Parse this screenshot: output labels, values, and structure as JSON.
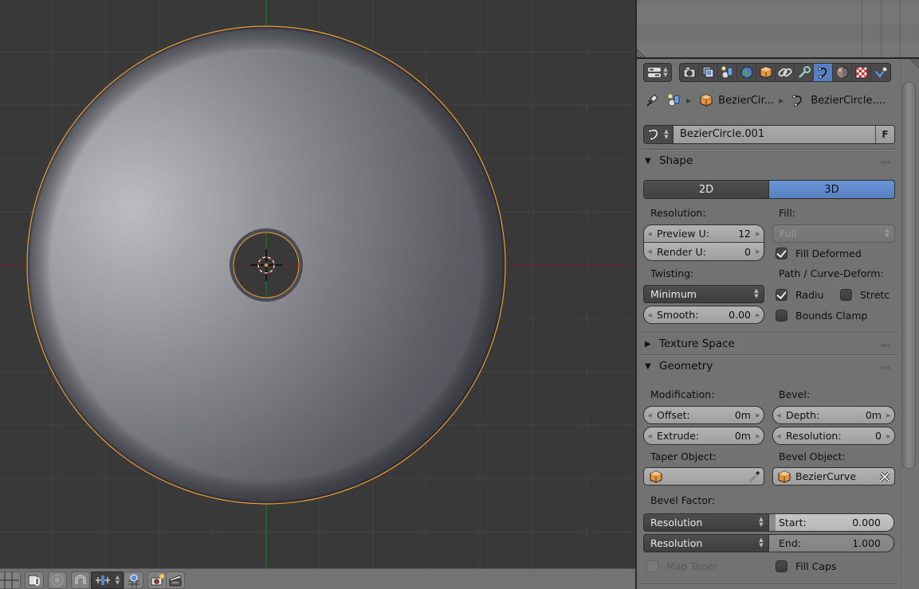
{
  "viewport": {
    "axis_colors": {
      "x_axis": "#7f1e1e",
      "y_axis": "#1e7f1e"
    },
    "selection_color": "#f0a030",
    "object": "bevelled bezier circle (disc), top view, solid shading",
    "header_buttons": [
      {
        "name": "view-layers-grid",
        "icon": "grid-icon"
      },
      {
        "name": "pivot-link",
        "icon": "link-pivot-icon"
      },
      {
        "name": "proportional-editing",
        "icon": "proportional-circle-icon"
      },
      {
        "name": "snap-toggle",
        "icon": "magnet-icon"
      },
      {
        "name": "snap-element",
        "icon": "snap-increment-icon"
      },
      {
        "name": "snap-target",
        "icon": "snap-grid-icon"
      },
      {
        "name": "opengl-render",
        "icon": "camera-render-icon"
      },
      {
        "name": "opengl-animation",
        "icon": "clapperboard-icon"
      }
    ]
  },
  "properties": {
    "context_tabs": [
      {
        "name": "render",
        "icon": "camera-icon",
        "active": false
      },
      {
        "name": "render-layers",
        "icon": "render-layers-icon",
        "active": false
      },
      {
        "name": "scene",
        "icon": "scene-icon",
        "active": false
      },
      {
        "name": "world",
        "icon": "world-icon",
        "active": false
      },
      {
        "name": "object",
        "icon": "cube-icon",
        "active": false
      },
      {
        "name": "constraints",
        "icon": "chain-link-icon",
        "active": false
      },
      {
        "name": "modifiers",
        "icon": "wrench-icon",
        "active": false
      },
      {
        "name": "curve-data",
        "icon": "curve-icon",
        "active": true
      },
      {
        "name": "material",
        "icon": "material-sphere-icon",
        "active": false
      },
      {
        "name": "texture",
        "icon": "checker-texture-icon",
        "active": false
      },
      {
        "name": "physics",
        "icon": "physics-icon",
        "active": false
      }
    ],
    "breadcrumb": {
      "object": "BezierCir...",
      "data": "BezierCircle...."
    },
    "datablock": {
      "name": "BezierCircle.001",
      "fake_user_label": "F"
    },
    "shape": {
      "title": "Shape",
      "dimensions": {
        "options": [
          "2D",
          "3D"
        ],
        "selected": "3D"
      },
      "resolution_label": "Resolution:",
      "preview_u": {
        "label": "Preview U:",
        "value": "12"
      },
      "render_u": {
        "label": "Render U:",
        "value": "0"
      },
      "fill_label": "Fill:",
      "fill_mode": "Full",
      "fill_deformed": {
        "label": "Fill Deformed",
        "checked": true
      },
      "twisting_label": "Twisting:",
      "twisting_mode": "Minimum",
      "smooth": {
        "label": "Smooth:",
        "value": "0.00"
      },
      "path_label": "Path / Curve-Deform:",
      "radius": {
        "label": "Radiu",
        "checked": true
      },
      "stretch": {
        "label": "Stretc",
        "checked": false
      },
      "bounds_clamp": {
        "label": "Bounds Clamp",
        "checked": false
      }
    },
    "texture_space": {
      "title": "Texture Space",
      "expanded": false
    },
    "geometry": {
      "title": "Geometry",
      "modification_label": "Modification:",
      "offset": {
        "label": "Offset:",
        "value": "0m"
      },
      "extrude": {
        "label": "Extrude:",
        "value": "0m"
      },
      "bevel_label": "Bevel:",
      "depth": {
        "label": "Depth:",
        "value": "0m"
      },
      "resolution": {
        "label": "Resolution:",
        "value": "0"
      },
      "taper_object_label": "Taper Object:",
      "taper_object": "",
      "bevel_object_label": "Bevel Object:",
      "bevel_object": "BezierCurve",
      "bevel_factor_label": "Bevel Factor:",
      "factor_start": {
        "mapping": "Resolution",
        "label": "Start:",
        "value": "0.000",
        "fraction": 0.0
      },
      "factor_end": {
        "mapping": "Resolution",
        "label": "End:",
        "value": "1.000",
        "fraction": 1.0
      },
      "map_taper": {
        "label": "Map Taper",
        "checked": false,
        "enabled": false
      },
      "fill_caps": {
        "label": "Fill Caps",
        "checked": false
      }
    }
  }
}
